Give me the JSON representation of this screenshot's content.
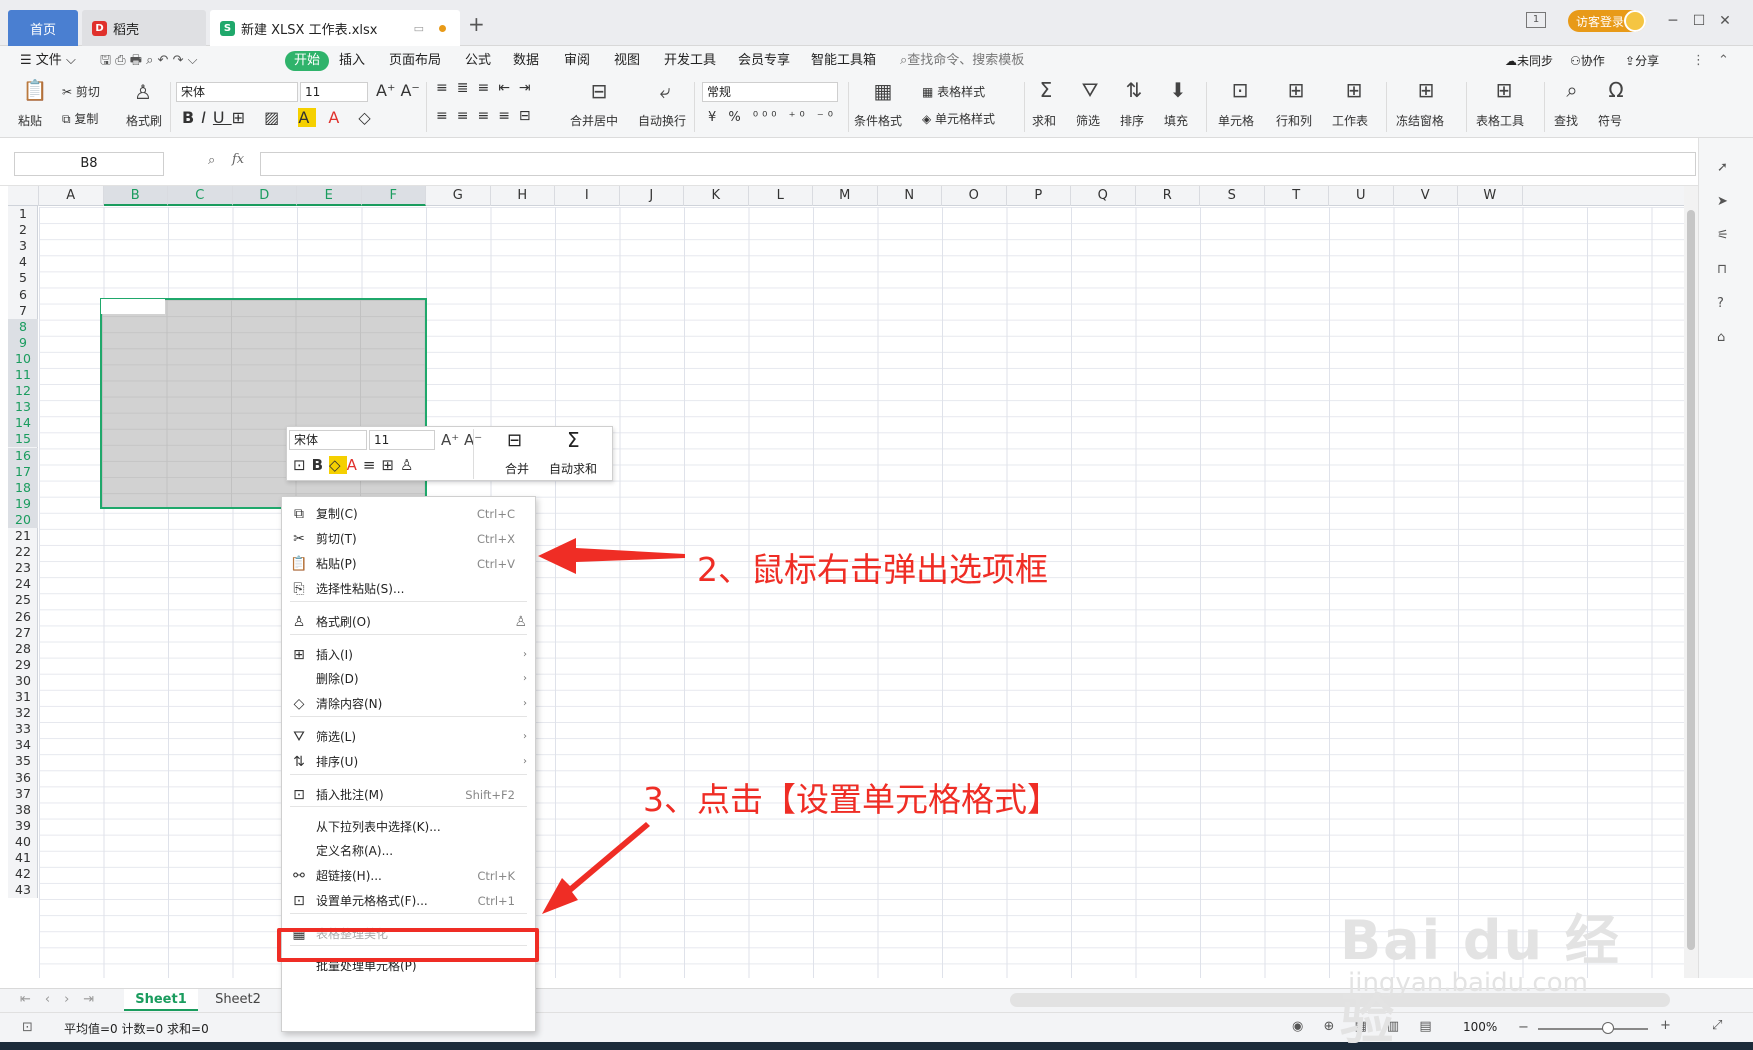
{
  "titlebar": {
    "tab_home": "首页",
    "tab_daoke": "稻壳",
    "tab_doc": "新建 XLSX 工作表.xlsx",
    "tab_add": "+",
    "login": "访客登录",
    "window_badge": "1"
  },
  "menubar": {
    "file": "文件",
    "items": [
      "开始",
      "插入",
      "页面布局",
      "公式",
      "数据",
      "审阅",
      "视图",
      "开发工具",
      "会员专享",
      "智能工具箱"
    ],
    "search": "查找命令、搜索模板",
    "sync": "未同步",
    "collab": "协作",
    "share": "分享"
  },
  "ribbon": {
    "paste": "粘贴",
    "cut": "剪切",
    "copy": "复制",
    "format_painter": "格式刷",
    "font_name": "宋体",
    "font_size": "11",
    "merge_center": "合并居中",
    "wrap": "自动换行",
    "number_format": "常规",
    "cond_format": "条件格式",
    "table_style": "表格样式",
    "cell_style": "单元格样式",
    "sum": "求和",
    "filter": "筛选",
    "sort": "排序",
    "fill": "填充",
    "cells": "单元格",
    "row_col": "行和列",
    "sheet": "工作表",
    "freeze": "冻结窗格",
    "table_tools": "表格工具",
    "find": "查找",
    "symbol": "符号"
  },
  "formula_bar": {
    "name_box": "B8",
    "fx": "fx",
    "value": ""
  },
  "grid": {
    "columns": [
      "A",
      "B",
      "C",
      "D",
      "E",
      "F",
      "G",
      "H",
      "I",
      "J",
      "K",
      "L",
      "M",
      "N",
      "O",
      "P",
      "Q",
      "R",
      "S",
      "T",
      "U",
      "V",
      "W"
    ],
    "selected_columns": [
      "B",
      "C",
      "D",
      "E",
      "F"
    ],
    "rows": [
      "1",
      "2",
      "3",
      "4",
      "5",
      "6",
      "7",
      "8",
      "9",
      "10",
      "11",
      "12",
      "13",
      "14",
      "15",
      "16",
      "17",
      "18",
      "19",
      "20",
      "21",
      "22",
      "23",
      "24",
      "25",
      "26",
      "27",
      "28",
      "29",
      "30",
      "31",
      "32",
      "33",
      "34",
      "35",
      "36",
      "37",
      "38",
      "39",
      "40",
      "41",
      "42",
      "43"
    ],
    "selected_rows_from": "8",
    "selected_rows_to": "20"
  },
  "mini_toolbar": {
    "font_name": "宋体",
    "font_size": "11",
    "merge": "合并",
    "autosum": "自动求和"
  },
  "context_menu": {
    "items": [
      {
        "label": "复制(C)",
        "shortcut": "Ctrl+C",
        "icon": "copy-icon"
      },
      {
        "label": "剪切(T)",
        "shortcut": "Ctrl+X",
        "icon": "scissors-icon"
      },
      {
        "label": "粘贴(P)",
        "shortcut": "Ctrl+V",
        "icon": "paste-icon"
      },
      {
        "label": "选择性粘贴(S)...",
        "shortcut": "",
        "icon": "paste-special-icon"
      },
      {
        "label": "格式刷(O)",
        "shortcut": "",
        "icon": "brush-icon"
      },
      {
        "label": "插入(I)",
        "shortcut": "",
        "icon": "insert-icon"
      },
      {
        "label": "删除(D)",
        "shortcut": "",
        "icon": ""
      },
      {
        "label": "清除内容(N)",
        "shortcut": "",
        "icon": "eraser-icon"
      },
      {
        "label": "筛选(L)",
        "shortcut": "",
        "icon": "filter-icon"
      },
      {
        "label": "排序(U)",
        "shortcut": "",
        "icon": "sort-icon"
      },
      {
        "label": "插入批注(M)",
        "shortcut": "Shift+F2",
        "icon": "comment-icon"
      },
      {
        "label": "从下拉列表中选择(K)...",
        "shortcut": "",
        "icon": ""
      },
      {
        "label": "定义名称(A)...",
        "shortcut": "",
        "icon": ""
      },
      {
        "label": "超链接(H)...",
        "shortcut": "Ctrl+K",
        "icon": "link-icon"
      },
      {
        "label": "设置单元格格式(F)...",
        "shortcut": "Ctrl+1",
        "icon": "cell-format-icon"
      },
      {
        "label": "表格整理美化",
        "shortcut": "",
        "icon": "beautify-icon"
      },
      {
        "label": "批量处理单元格(P)",
        "shortcut": "",
        "icon": ""
      }
    ]
  },
  "annotations": {
    "step2": "2、鼠标右击弹出选项框",
    "step3": "3、点击【设置单元格格式】"
  },
  "sheets": {
    "tabs": [
      "Sheet1",
      "Sheet2"
    ],
    "active": "Sheet1"
  },
  "status": {
    "text": "平均值=0  计数=0  求和=0",
    "zoom": "100%"
  },
  "watermark": {
    "brand": "Bai du 经验",
    "url": "jingyan.baidu.com"
  },
  "colors": {
    "accent": "#1fa86b",
    "annotation": "#ef2d25",
    "home_tab": "#4a7fd1",
    "login": "#e89a18"
  }
}
